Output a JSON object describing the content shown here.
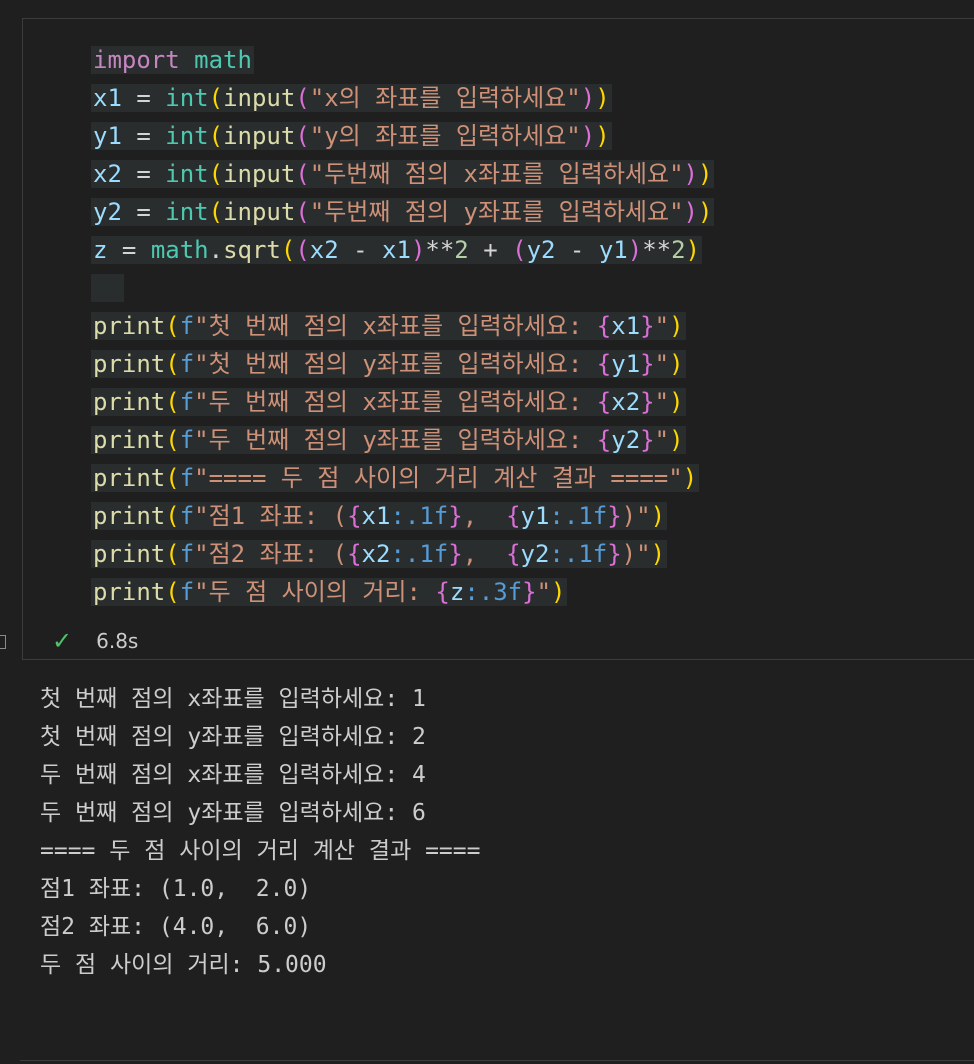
{
  "code_lines": [
    {
      "id": "l1",
      "segments": [
        [
          "kw",
          "import"
        ],
        [
          "op",
          " "
        ],
        [
          "mod",
          "math"
        ]
      ]
    },
    {
      "id": "l2",
      "segments": [
        [
          "var",
          "x1"
        ],
        [
          "op",
          " = "
        ],
        [
          "bi",
          "int"
        ],
        [
          "p1",
          "("
        ],
        [
          "fn",
          "input"
        ],
        [
          "p2",
          "("
        ],
        [
          "str",
          "\"x의 좌표를 입력하세요\""
        ],
        [
          "p2",
          ")"
        ],
        [
          "p1",
          ")"
        ]
      ]
    },
    {
      "id": "l3",
      "segments": [
        [
          "var",
          "y1"
        ],
        [
          "op",
          " = "
        ],
        [
          "bi",
          "int"
        ],
        [
          "p1",
          "("
        ],
        [
          "fn",
          "input"
        ],
        [
          "p2",
          "("
        ],
        [
          "str",
          "\"y의 좌표를 입력하세요\""
        ],
        [
          "p2",
          ")"
        ],
        [
          "p1",
          ")"
        ]
      ]
    },
    {
      "id": "l4",
      "segments": [
        [
          "var",
          "x2"
        ],
        [
          "op",
          " = "
        ],
        [
          "bi",
          "int"
        ],
        [
          "p1",
          "("
        ],
        [
          "fn",
          "input"
        ],
        [
          "p2",
          "("
        ],
        [
          "str",
          "\"두번째 점의 x좌표를 입력하세요\""
        ],
        [
          "p2",
          ")"
        ],
        [
          "p1",
          ")"
        ]
      ]
    },
    {
      "id": "l5",
      "segments": [
        [
          "var",
          "y2"
        ],
        [
          "op",
          " = "
        ],
        [
          "bi",
          "int"
        ],
        [
          "p1",
          "("
        ],
        [
          "fn",
          "input"
        ],
        [
          "p2",
          "("
        ],
        [
          "str",
          "\"두번째 점의 y좌표를 입력하세요\""
        ],
        [
          "p2",
          ")"
        ],
        [
          "p1",
          ")"
        ]
      ]
    },
    {
      "id": "l6",
      "segments": [
        [
          "var",
          "z"
        ],
        [
          "op",
          " = "
        ],
        [
          "mod",
          "math"
        ],
        [
          "op",
          "."
        ],
        [
          "fn",
          "sqrt"
        ],
        [
          "p1",
          "("
        ],
        [
          "p2",
          "("
        ],
        [
          "var",
          "x2"
        ],
        [
          "op",
          " - "
        ],
        [
          "var",
          "x1"
        ],
        [
          "p2",
          ")"
        ],
        [
          "op",
          "**"
        ],
        [
          "num",
          "2"
        ],
        [
          "op",
          " + "
        ],
        [
          "p2",
          "("
        ],
        [
          "var",
          "y2"
        ],
        [
          "op",
          " - "
        ],
        [
          "var",
          "y1"
        ],
        [
          "p2",
          ")"
        ],
        [
          "op",
          "**"
        ],
        [
          "num",
          "2"
        ],
        [
          "p1",
          ")"
        ]
      ]
    },
    {
      "id": "l7",
      "segments": [
        [
          "op",
          "  "
        ]
      ]
    },
    {
      "id": "l8",
      "segments": [
        [
          "fn",
          "print"
        ],
        [
          "p1",
          "("
        ],
        [
          "fpre",
          "f"
        ],
        [
          "str",
          "\"첫 번째 점의 x좌표를 입력하세요: "
        ],
        [
          "brace",
          "{"
        ],
        [
          "var",
          "x1"
        ],
        [
          "brace",
          "}"
        ],
        [
          "str",
          "\""
        ],
        [
          "p1",
          ")"
        ]
      ]
    },
    {
      "id": "l9",
      "segments": [
        [
          "fn",
          "print"
        ],
        [
          "p1",
          "("
        ],
        [
          "fpre",
          "f"
        ],
        [
          "str",
          "\"첫 번째 점의 y좌표를 입력하세요: "
        ],
        [
          "brace",
          "{"
        ],
        [
          "var",
          "y1"
        ],
        [
          "brace",
          "}"
        ],
        [
          "str",
          "\""
        ],
        [
          "p1",
          ")"
        ]
      ]
    },
    {
      "id": "l10",
      "segments": [
        [
          "fn",
          "print"
        ],
        [
          "p1",
          "("
        ],
        [
          "fpre",
          "f"
        ],
        [
          "str",
          "\"두 번째 점의 x좌표를 입력하세요: "
        ],
        [
          "brace",
          "{"
        ],
        [
          "var",
          "x2"
        ],
        [
          "brace",
          "}"
        ],
        [
          "str",
          "\""
        ],
        [
          "p1",
          ")"
        ]
      ]
    },
    {
      "id": "l11",
      "segments": [
        [
          "fn",
          "print"
        ],
        [
          "p1",
          "("
        ],
        [
          "fpre",
          "f"
        ],
        [
          "str",
          "\"두 번째 점의 y좌표를 입력하세요: "
        ],
        [
          "brace",
          "{"
        ],
        [
          "var",
          "y2"
        ],
        [
          "brace",
          "}"
        ],
        [
          "str",
          "\""
        ],
        [
          "p1",
          ")"
        ]
      ]
    },
    {
      "id": "l12",
      "segments": [
        [
          "fn",
          "print"
        ],
        [
          "p1",
          "("
        ],
        [
          "fpre",
          "f"
        ],
        [
          "str",
          "\"==== 두 점 사이의 거리 계산 결과 ====\""
        ],
        [
          "p1",
          ")"
        ]
      ]
    },
    {
      "id": "l13",
      "segments": [
        [
          "fn",
          "print"
        ],
        [
          "p1",
          "("
        ],
        [
          "fpre",
          "f"
        ],
        [
          "str",
          "\"점1 좌표: ("
        ],
        [
          "brace",
          "{"
        ],
        [
          "var",
          "x1"
        ],
        [
          "fmt",
          ":.1f"
        ],
        [
          "brace",
          "}"
        ],
        [
          "str",
          ",  "
        ],
        [
          "brace",
          "{"
        ],
        [
          "var",
          "y1"
        ],
        [
          "fmt",
          ":.1f"
        ],
        [
          "brace",
          "}"
        ],
        [
          "str",
          ")\""
        ],
        [
          "p1",
          ")"
        ]
      ]
    },
    {
      "id": "l14",
      "segments": [
        [
          "fn",
          "print"
        ],
        [
          "p1",
          "("
        ],
        [
          "fpre",
          "f"
        ],
        [
          "str",
          "\"점2 좌표: ("
        ],
        [
          "brace",
          "{"
        ],
        [
          "var",
          "x2"
        ],
        [
          "fmt",
          ":.1f"
        ],
        [
          "brace",
          "}"
        ],
        [
          "str",
          ",  "
        ],
        [
          "brace",
          "{"
        ],
        [
          "var",
          "y2"
        ],
        [
          "fmt",
          ":.1f"
        ],
        [
          "brace",
          "}"
        ],
        [
          "str",
          ")\""
        ],
        [
          "p1",
          ")"
        ]
      ]
    },
    {
      "id": "l15",
      "segments": [
        [
          "fn",
          "print"
        ],
        [
          "p1",
          "("
        ],
        [
          "fpre",
          "f"
        ],
        [
          "str",
          "\"두 점 사이의 거리: "
        ],
        [
          "brace",
          "{"
        ],
        [
          "var",
          "z"
        ],
        [
          "fmt",
          ":.3f"
        ],
        [
          "brace",
          "}"
        ],
        [
          "str",
          "\""
        ],
        [
          "p1",
          ")"
        ]
      ]
    }
  ],
  "status": {
    "icon": "check-icon",
    "time": "6.8s"
  },
  "output_lines": [
    "첫 번째 점의 x좌표를 입력하세요: 1",
    "첫 번째 점의 y좌표를 입력하세요: 2",
    "두 번째 점의 x좌표를 입력하세요: 4",
    "두 번째 점의 y좌표를 입력하세요: 6",
    "==== 두 점 사이의 거리 계산 결과 ====",
    "점1 좌표: (1.0,  2.0)",
    "점2 좌표: (4.0,  6.0)",
    "두 점 사이의 거리: 5.000"
  ]
}
